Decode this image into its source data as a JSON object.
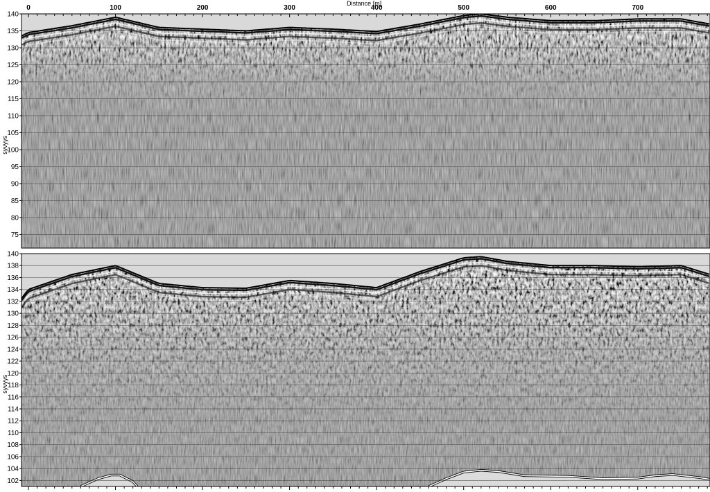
{
  "chart_data": [
    {
      "type": "heatmap",
      "title": "",
      "xlabel": "Distance [m]",
      "ylabel": "syvyys",
      "xlim": [
        -8,
        783
      ],
      "ylim": [
        71,
        140
      ],
      "x_ticks": [
        0,
        100,
        200,
        300,
        400,
        500,
        600,
        700
      ],
      "y_ticks": [
        75,
        80,
        85,
        90,
        95,
        100,
        105,
        110,
        115,
        120,
        125,
        130,
        135,
        140
      ],
      "grid": true,
      "surface_profile": {
        "x": [
          -8,
          0,
          50,
          100,
          150,
          200,
          250,
          300,
          350,
          400,
          450,
          500,
          520,
          550,
          600,
          650,
          700,
          750,
          783
        ],
        "y": [
          133.5,
          134.5,
          136.5,
          139,
          136,
          135.5,
          135,
          136,
          135.5,
          134.8,
          137,
          139.5,
          140,
          139,
          138,
          138,
          138.5,
          138.5,
          137
        ]
      }
    },
    {
      "type": "heatmap",
      "title": "",
      "xlabel": "",
      "ylabel": "syvyys",
      "xlim": [
        -8,
        783
      ],
      "ylim": [
        101,
        140
      ],
      "y_ticks": [
        102,
        104,
        106,
        108,
        110,
        112,
        114,
        116,
        118,
        120,
        122,
        124,
        126,
        128,
        130,
        132,
        134,
        136,
        138,
        140
      ],
      "grid": true,
      "surface_profile": {
        "x": [
          -8,
          0,
          50,
          100,
          150,
          200,
          250,
          300,
          350,
          400,
          450,
          500,
          520,
          550,
          600,
          650,
          700,
          750,
          783
        ],
        "y": [
          132.5,
          134,
          136.5,
          138,
          135,
          134.3,
          134.2,
          135.5,
          135,
          134.3,
          137,
          139.3,
          139.5,
          138.7,
          138,
          138,
          137.8,
          138,
          136.5
        ]
      },
      "bedrock_profile": {
        "x": [
          60,
          80,
          95,
          105,
          120,
          125,
          460,
          480,
          500,
          520,
          540,
          570,
          620,
          660,
          700,
          720,
          740,
          770,
          783
        ],
        "y": [
          101,
          102.3,
          102.9,
          102.9,
          101.8,
          101,
          101,
          102.3,
          103.4,
          103.7,
          103.5,
          102.8,
          102.7,
          102.3,
          102.4,
          102.8,
          103,
          102.5,
          102.2
        ]
      }
    }
  ]
}
